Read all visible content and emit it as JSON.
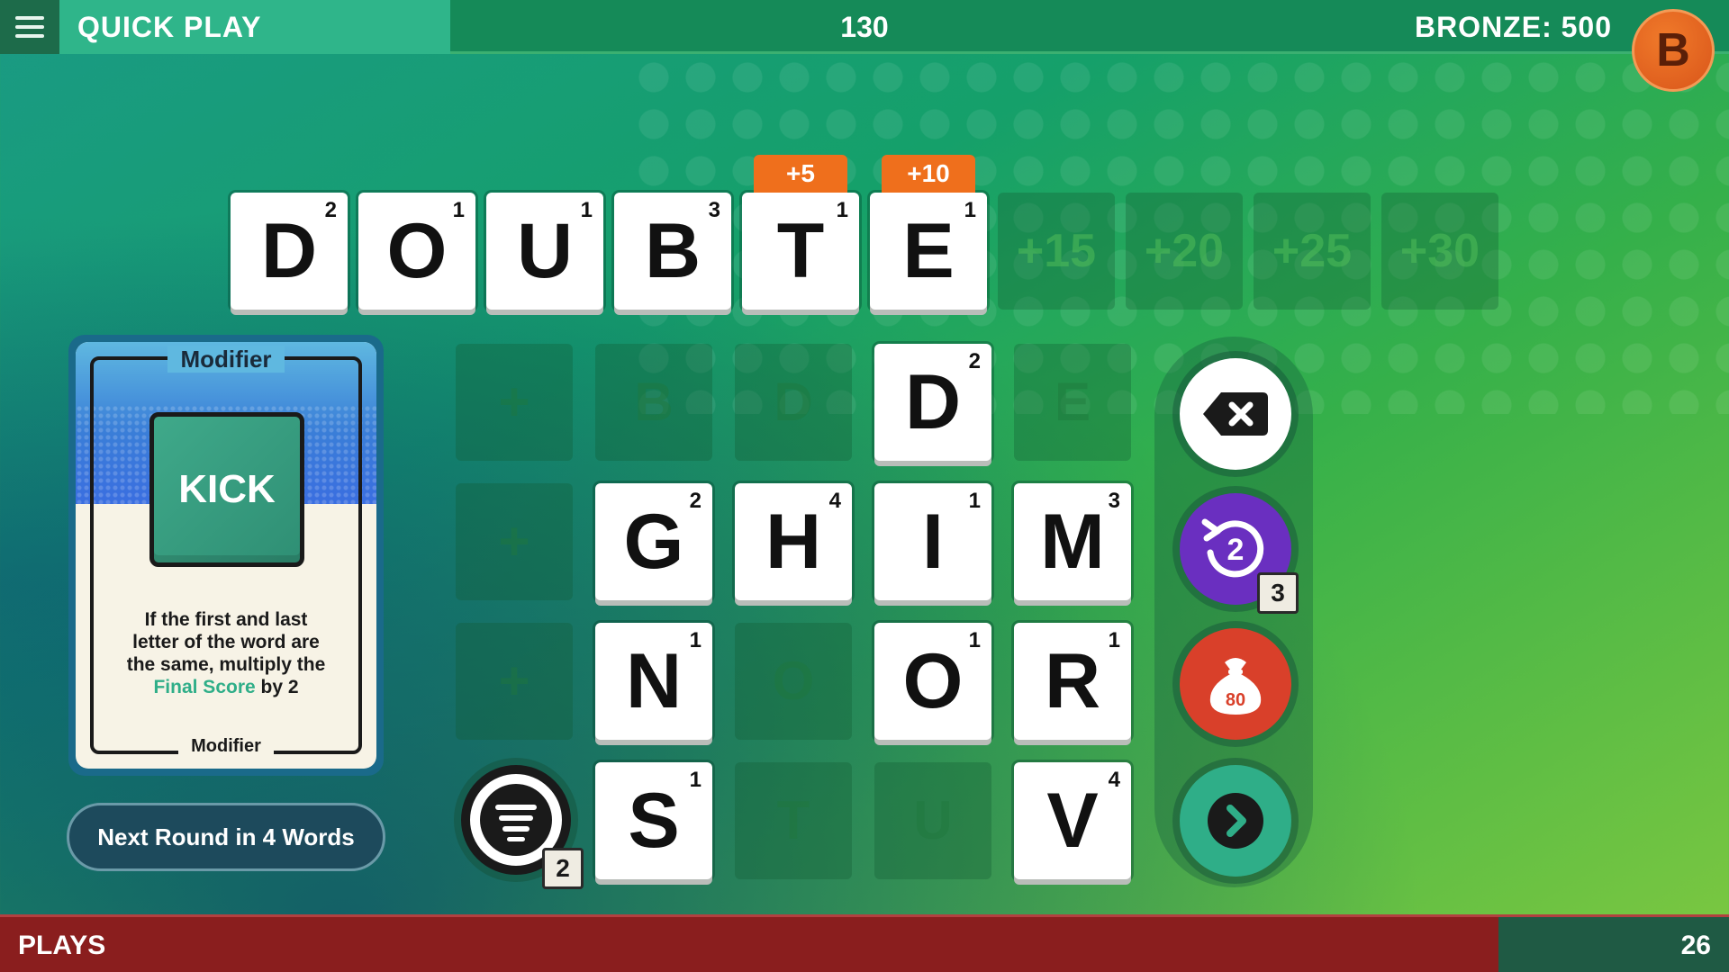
{
  "header": {
    "mode_title": "QUICK PLAY",
    "score": "130",
    "rank": "BRONZE: 500",
    "avatar_letter": "B"
  },
  "word_row": {
    "tiles": [
      {
        "letter": "D",
        "points": "2"
      },
      {
        "letter": "O",
        "points": "1"
      },
      {
        "letter": "U",
        "points": "1"
      },
      {
        "letter": "B",
        "points": "3"
      },
      {
        "letter": "T",
        "points": "1"
      },
      {
        "letter": "E",
        "points": "1"
      }
    ],
    "bonus_tags": [
      "+5",
      "+10"
    ],
    "empty_slots": [
      "+15",
      "+20",
      "+25",
      "+30"
    ]
  },
  "modifier_card": {
    "header_label": "Modifier",
    "name": "KICK",
    "description_lines": [
      "If the first and last",
      "letter of the word are",
      "the same, multiply the"
    ],
    "description_highlight": "Final Score",
    "description_tail": " by 2",
    "footer_label": "Modifier"
  },
  "next_round": "Next Round in 4 Words",
  "board": {
    "rows": [
      [
        {
          "type": "slot",
          "text": "+"
        },
        {
          "type": "slot",
          "text": "B"
        },
        {
          "type": "slot",
          "text": "D"
        },
        {
          "type": "tile",
          "letter": "D",
          "points": "2"
        },
        {
          "type": "slot",
          "text": "E"
        }
      ],
      [
        {
          "type": "slot",
          "text": "+"
        },
        {
          "type": "tile",
          "letter": "G",
          "points": "2"
        },
        {
          "type": "tile",
          "letter": "H",
          "points": "4"
        },
        {
          "type": "tile",
          "letter": "I",
          "points": "1"
        },
        {
          "type": "tile",
          "letter": "M",
          "points": "3"
        }
      ],
      [
        {
          "type": "slot",
          "text": "+"
        },
        {
          "type": "tile",
          "letter": "N",
          "points": "1"
        },
        {
          "type": "slot",
          "text": "O"
        },
        {
          "type": "tile",
          "letter": "O",
          "points": "1"
        },
        {
          "type": "tile",
          "letter": "R",
          "points": "1"
        }
      ],
      [
        {
          "type": "none",
          "text": ""
        },
        {
          "type": "tile",
          "letter": "S",
          "points": "1"
        },
        {
          "type": "slot",
          "text": "T"
        },
        {
          "type": "slot",
          "text": "U"
        },
        {
          "type": "tile",
          "letter": "V",
          "points": "4"
        }
      ]
    ],
    "sort_button": {
      "icon": "list-icon",
      "count": "2"
    }
  },
  "side_buttons": {
    "backspace": {
      "icon": "backspace-icon",
      "color": "#ffffff"
    },
    "shuffle": {
      "icon": "refresh-icon",
      "value": "2",
      "count": "3",
      "color": "#6a2fc0"
    },
    "bag": {
      "icon": "money-bag-icon",
      "value": "80",
      "color": "#d9402a"
    },
    "submit": {
      "icon": "arrow-right-icon",
      "color": "#2fae88"
    }
  },
  "footer": {
    "plays_label": "PLAYS",
    "plays_count": "26"
  }
}
